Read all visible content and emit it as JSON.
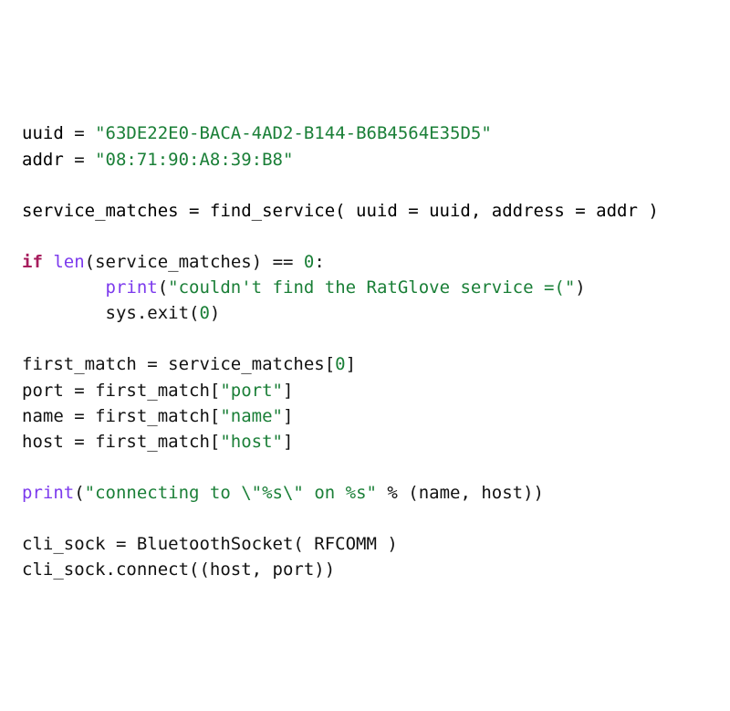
{
  "code": {
    "l1_var": "uuid",
    "l1_eq": " = ",
    "l1_str": "\"63DE22E0-BACA-4AD2-B144-B6B4564E35D5\"",
    "l2_var": "addr",
    "l2_eq": " = ",
    "l2_str": "\"08:71:90:A8:39:B8\"",
    "l4_a": "service_matches = find_service( uuid = uuid, address = addr )",
    "l6_if": "if",
    "l6_sp": " ",
    "l6_len": "len",
    "l6_rest": "(service_matches) == ",
    "l6_zero": "0",
    "l6_colon": ":",
    "l7_indent": "        ",
    "l7_print": "print",
    "l7_open": "(",
    "l7_str": "\"couldn't find the RatGlove service =(\"",
    "l7_close": ")",
    "l8_indent": "        ",
    "l8_rest": "sys.exit(",
    "l8_zero": "0",
    "l8_close": ")",
    "l10_a": "first_match = service_matches[",
    "l10_zero": "0",
    "l10_b": "]",
    "l11_a": "port = first_match[",
    "l11_str": "\"port\"",
    "l11_b": "]",
    "l12_a": "name = first_match[",
    "l12_str": "\"name\"",
    "l12_b": "]",
    "l13_a": "host = first_match[",
    "l13_str": "\"host\"",
    "l13_b": "]",
    "l15_print": "print",
    "l15_open": "(",
    "l15_str": "\"connecting to \\\"%s\\\" on %s\"",
    "l15_rest": " % (name, host))",
    "l17_a": "cli_sock = BluetoothSocket( RFCOMM )",
    "l18_a": "cli_sock.connect((host, port))"
  }
}
